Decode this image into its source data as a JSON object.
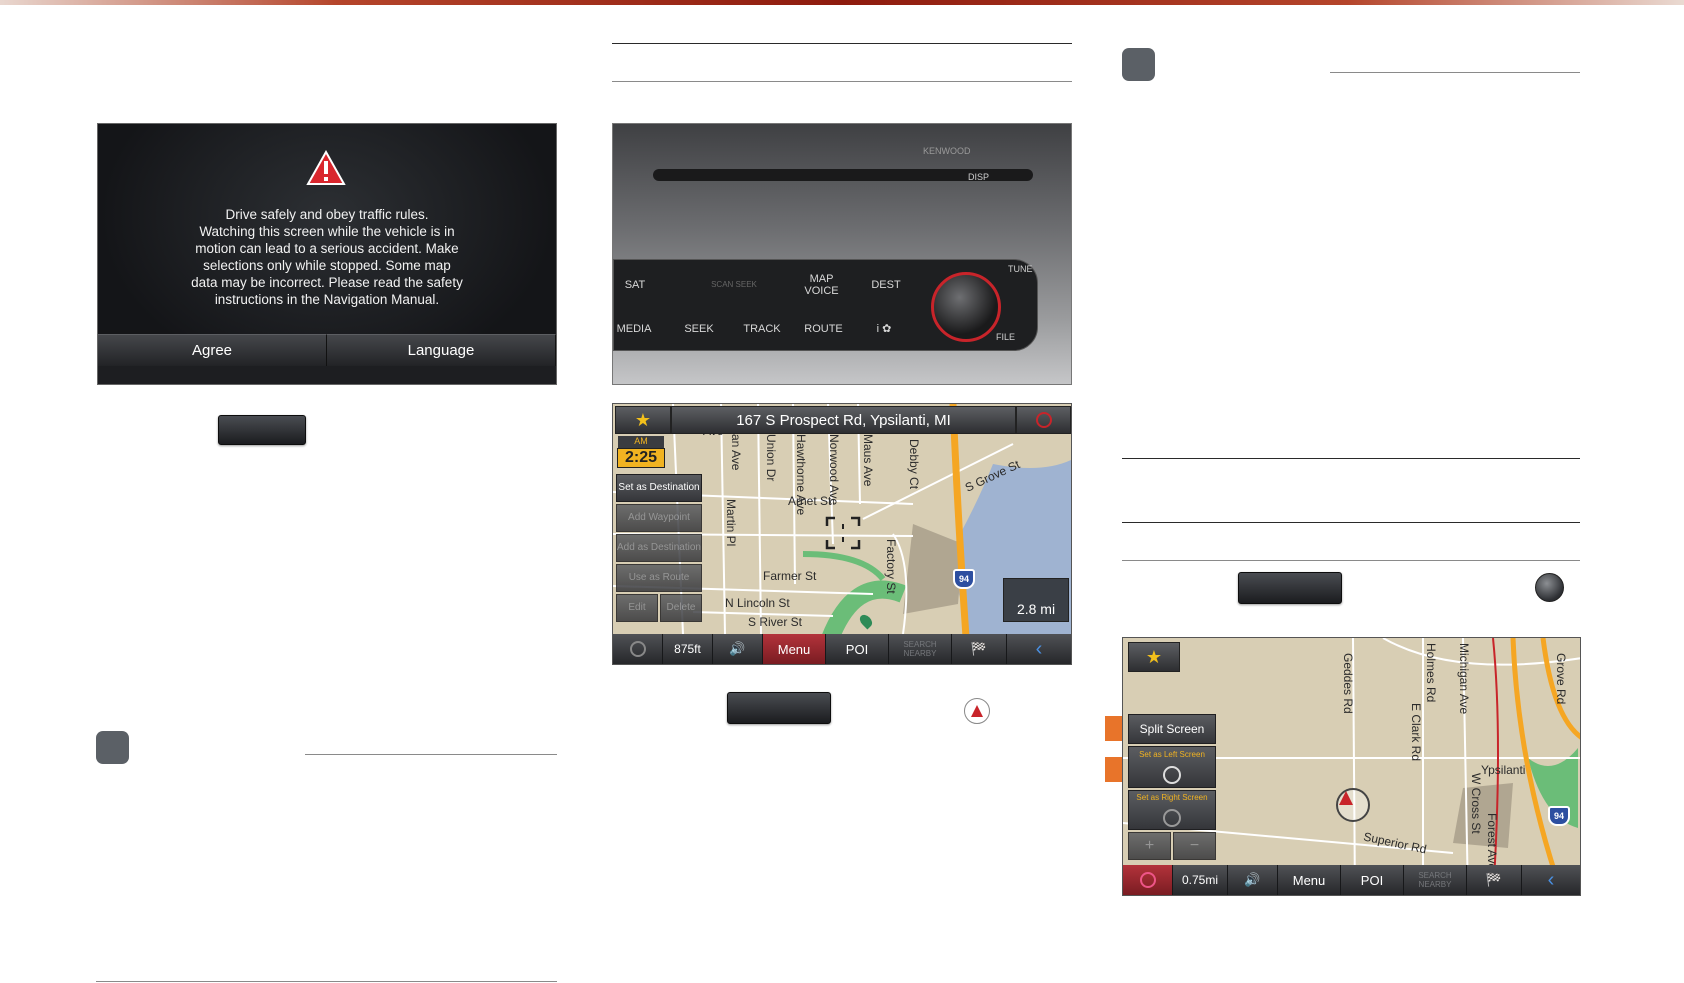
{
  "warning_screen": {
    "message_lines": [
      "Drive safely and obey traffic rules.",
      "Watching this screen while the vehicle is in",
      "motion can lead to a serious accident. Make",
      "selections only while stopped. Some map",
      "data may be incorrect. Please read the safety",
      "instructions in the Navigation Manual."
    ],
    "agree_label": "Agree",
    "language_label": "Language"
  },
  "head_unit": {
    "brand": "KENWOOD",
    "disp": "DISP",
    "sat": "SAT",
    "slot": "SCAN SEEK",
    "map_voice": "MAP VOICE",
    "dest": "DEST",
    "tune": "TUNE",
    "media": "MEDIA",
    "seek": "SEEK",
    "track": "TRACK",
    "route": "ROUTE",
    "info": "i ✿",
    "file": "FILE"
  },
  "map1": {
    "address": "167 S Prospect Rd, Ypsilanti, MI",
    "ampm": "AM",
    "time": "2:25",
    "side_buttons": [
      "Set as Destination",
      "Add Waypoint",
      "Add as Destination",
      "Use as Route",
      "Edit",
      "Delete"
    ],
    "streets": [
      "Ave",
      "Martin Pl",
      "Arnet St",
      "Farmer St",
      "N Lincoln St",
      "S River St",
      "S Grove St",
      "Debby Ct",
      "Factory St",
      "Maus Ave",
      "Norwood Ave",
      "Hawthorne Ave",
      "Union Dr",
      "an Ave"
    ],
    "interstate": "94",
    "distance": "2.8 mi",
    "scale": "875ft",
    "bottom_buttons": {
      "menu": "Menu",
      "poi": "POI",
      "search": "SEARCH NEARBY"
    }
  },
  "map2": {
    "side_buttons": [
      "Split Screen",
      "Set as Left Screen",
      "Set as Right Screen"
    ],
    "streets": [
      "Geddes Rd",
      "E Clark Rd",
      "Holmes Rd",
      "Michigan Ave",
      "Ypsilanti",
      "Superior Rd",
      "Grove Rd",
      "Forest Ave",
      "W Cross St"
    ],
    "interstate": "94",
    "scale": "0.75mi",
    "bottom_buttons": {
      "menu": "Menu",
      "poi": "POI",
      "search": "SEARCH NEARBY"
    }
  }
}
